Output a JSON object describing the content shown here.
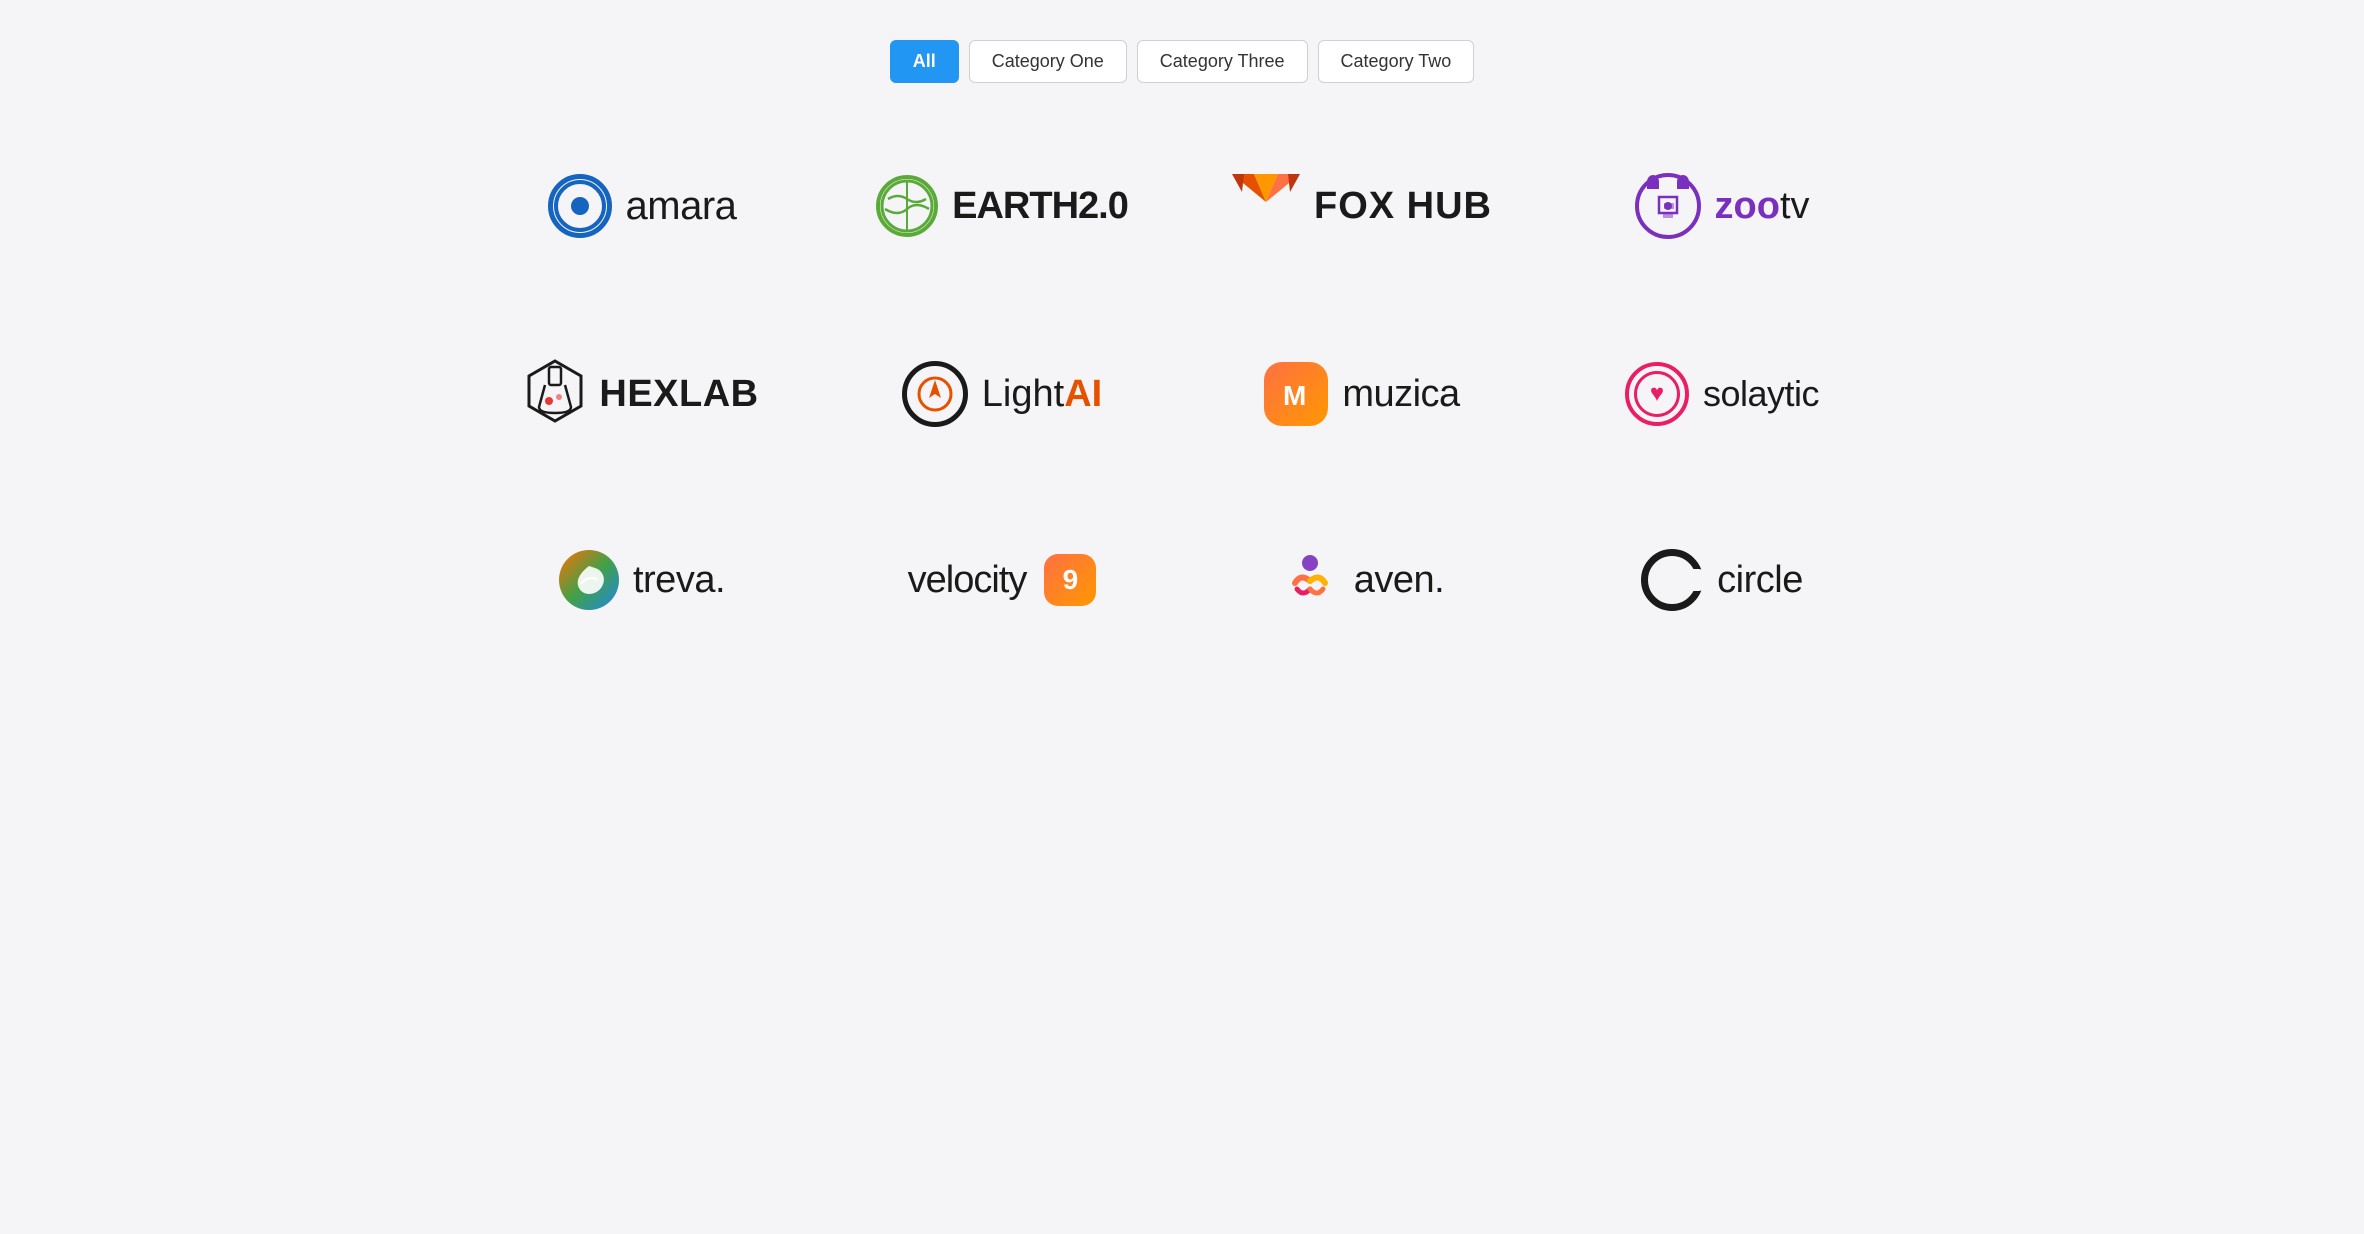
{
  "filter": {
    "buttons": [
      {
        "id": "all",
        "label": "All",
        "active": true
      },
      {
        "id": "cat1",
        "label": "Category One",
        "active": false
      },
      {
        "id": "cat3",
        "label": "Category Three",
        "active": false
      },
      {
        "id": "cat2",
        "label": "Category Two",
        "active": false
      }
    ]
  },
  "logos": [
    {
      "id": "amara",
      "name": "amara"
    },
    {
      "id": "earth20",
      "name": "EARTH2.0"
    },
    {
      "id": "foxhub",
      "name": "FOX HUB"
    },
    {
      "id": "zootv",
      "name": "zootv"
    },
    {
      "id": "hexlab",
      "name": "HEXLAB"
    },
    {
      "id": "lightai",
      "name": "LightAI"
    },
    {
      "id": "muzica",
      "name": "muzica"
    },
    {
      "id": "solaytic",
      "name": "solaytic"
    },
    {
      "id": "treva",
      "name": "treva."
    },
    {
      "id": "velocity9",
      "name": "velocity 9"
    },
    {
      "id": "aven",
      "name": "aven."
    },
    {
      "id": "circle",
      "name": "circle"
    }
  ]
}
